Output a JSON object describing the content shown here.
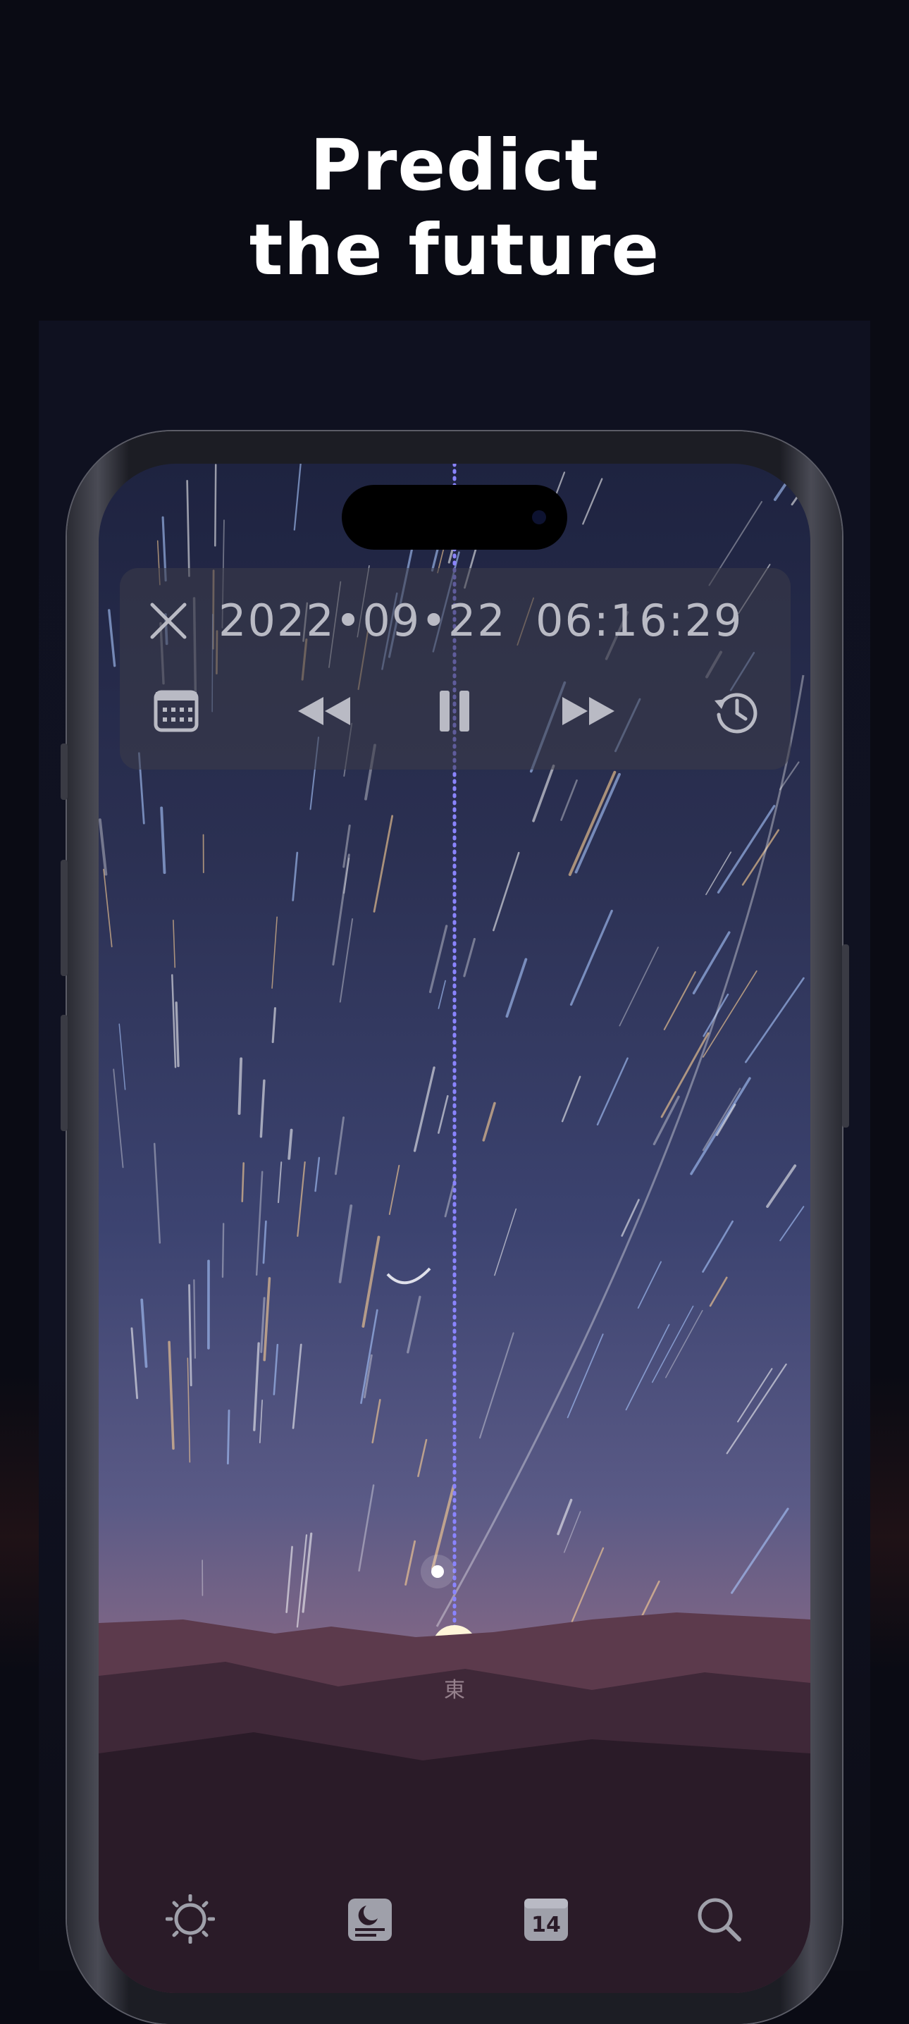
{
  "headline": {
    "line1": "Predict",
    "line2": "the future"
  },
  "time_controls": {
    "date": "2022•09•22",
    "time": "06:16:29",
    "icons": [
      "close-icon",
      "calendar-icon",
      "rewind-icon",
      "pause-icon",
      "fast-forward-icon",
      "history-icon"
    ]
  },
  "sky": {
    "horizon_label": "東"
  },
  "tab_bar": {
    "items": [
      "sun-icon",
      "moon-card-icon",
      "calendar-day-icon",
      "search-icon"
    ],
    "calendar_day": "14"
  },
  "colors": {
    "background": "#0a0b14",
    "panel": "#3c3c48",
    "sunrise": "#f2a25a"
  }
}
